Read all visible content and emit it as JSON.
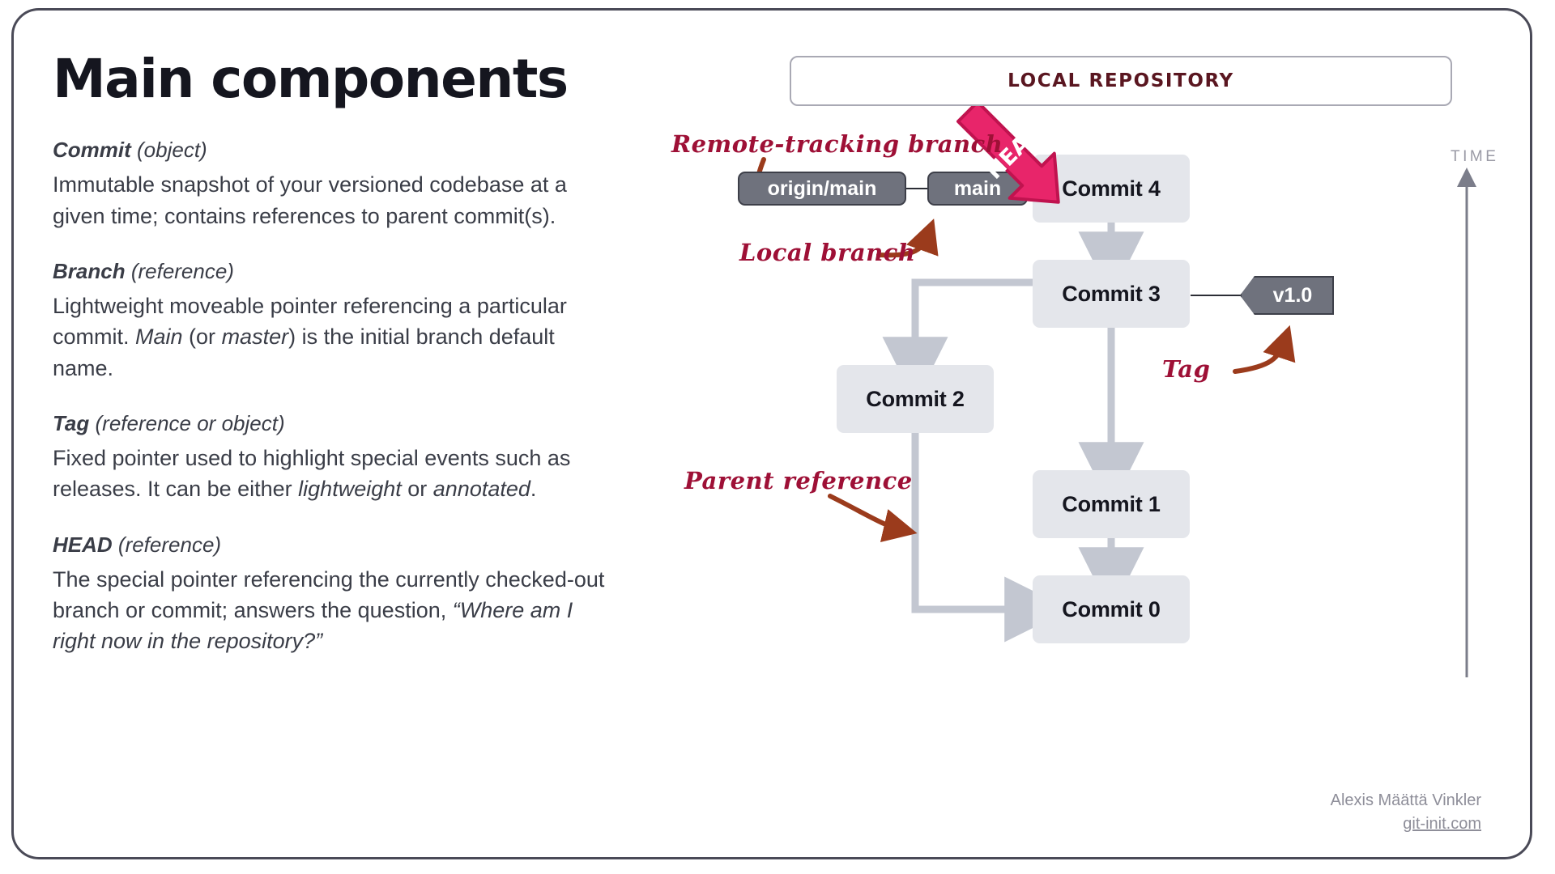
{
  "page_title": "Main components",
  "terms": [
    {
      "name": "Commit",
      "kind": "(object)",
      "description": "Immutable snapshot of your versioned codebase at a given time; contains references to parent commit(s)."
    },
    {
      "name": "Branch",
      "kind": "(reference)",
      "description": "Lightweight moveable pointer referencing a particular commit. Main (or master) is the initial branch default name."
    },
    {
      "name": "Tag",
      "kind": "(reference or object)",
      "description": "Fixed pointer used to highlight special events such as releases. It can be either lightweight or annotated."
    },
    {
      "name": "HEAD",
      "kind": "(reference)",
      "description": "The special pointer referencing the currently checked-out branch or commit; answers the question, “Where am I right now in the repository?”"
    }
  ],
  "diagram": {
    "banner": "LOCAL REPOSITORY",
    "time_axis_label": "TIME",
    "commits": [
      {
        "id": "commit4",
        "label": "Commit 4"
      },
      {
        "id": "commit3",
        "label": "Commit 3"
      },
      {
        "id": "commit2",
        "label": "Commit 2"
      },
      {
        "id": "commit1",
        "label": "Commit 1"
      },
      {
        "id": "commit0",
        "label": "Commit 0"
      }
    ],
    "refs": {
      "remote_tracking": "origin/main",
      "local": "main",
      "head": "HEAD",
      "tag": "v1.0"
    },
    "annotations": {
      "remote_tracking": "Remote-tracking branch",
      "local_branch": "Local branch",
      "tag": "Tag",
      "parent_reference": "Parent reference"
    },
    "colors": {
      "accent_pink": "#e8256a",
      "annotation_red": "#9e1036",
      "arrow_brown": "#9b3b1c",
      "commit_box": "#e4e6eb",
      "ref_pill": "#6f727d",
      "connector": "#c3c7d1",
      "banner_text": "#5a1620"
    }
  },
  "credit": {
    "author": "Alexis Määttä Vinkler",
    "site": "git-init.com"
  }
}
